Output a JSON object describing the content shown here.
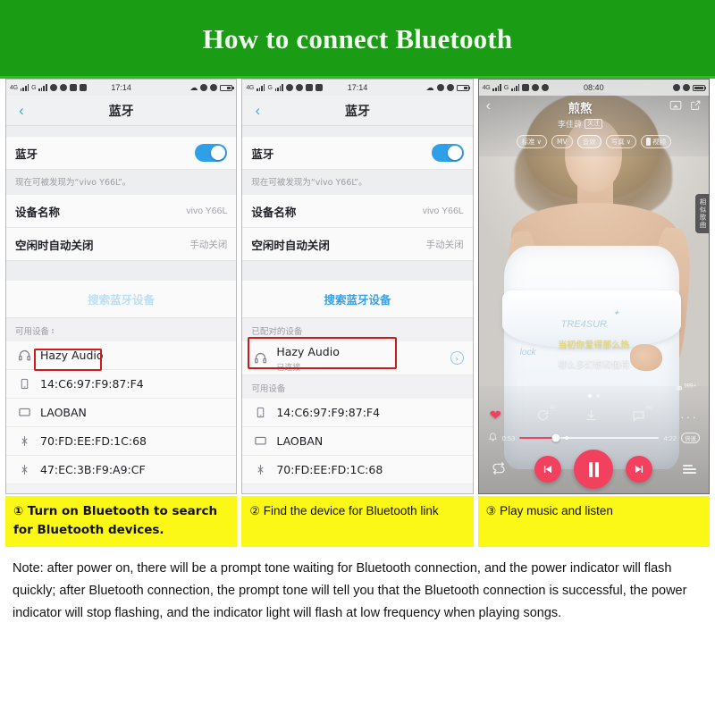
{
  "header": {
    "title": "How to connect Bluetooth",
    "bg": "#1a9d14",
    "text_color": "#f2fff0"
  },
  "accents": {
    "yellow": "#fbf717",
    "red_box": "#cf1a1a",
    "link_blue": "#3aa0e5",
    "toggle_blue": "#2f9fe8",
    "player_pink": "#f2415f"
  },
  "panel1": {
    "statusbar": {
      "net1": "4G",
      "net2": "G",
      "time": "17:14"
    },
    "nav": {
      "back": "‹",
      "title": "蓝牙"
    },
    "bluetooth_row": {
      "label": "蓝牙",
      "toggle_on": true
    },
    "discoverable_note": "现在可被发现为“vivo Y66L”。",
    "device_name_row": {
      "label": "设备名称",
      "value": "vivo Y66L"
    },
    "auto_off_row": {
      "label": "空闲时自动关闭",
      "value": "手动关闭"
    },
    "search_link": "搜索蓝牙设备",
    "available_label": "可用设备",
    "devices": [
      {
        "icon": "headphones-icon",
        "name": "Hazy Audio",
        "highlighted": true
      },
      {
        "icon": "phone-icon",
        "name": "14:C6:97:F9:87:F4",
        "highlighted": false
      },
      {
        "icon": "laptop-icon",
        "name": "LAOBAN",
        "highlighted": false
      },
      {
        "icon": "bluetooth-icon",
        "name": "70:FD:EE:FD:1C:68",
        "highlighted": false
      },
      {
        "icon": "bluetooth-icon",
        "name": "47:EC:3B:F9:A9:CF",
        "highlighted": false
      }
    ]
  },
  "panel2": {
    "statusbar": {
      "net1": "4G",
      "net2": "G",
      "time": "17:14"
    },
    "nav": {
      "back": "‹",
      "title": "蓝牙"
    },
    "bluetooth_row": {
      "label": "蓝牙",
      "toggle_on": true
    },
    "discoverable_note": "现在可被发现为“vivo Y66L”。",
    "device_name_row": {
      "label": "设备名称",
      "value": "vivo Y66L"
    },
    "auto_off_row": {
      "label": "空闲时自动关闭",
      "value": "手动关闭"
    },
    "search_link": "搜索蓝牙设备",
    "paired_label": "已配对的设备",
    "paired_device": {
      "icon": "headphones-icon",
      "name": "Hazy Audio",
      "status": "已连接",
      "chevron": "›"
    },
    "available_label": "可用设备",
    "devices": [
      {
        "icon": "phone-icon",
        "name": "14:C6:97:F9:87:F4"
      },
      {
        "icon": "laptop-icon",
        "name": "LAOBAN"
      },
      {
        "icon": "bluetooth-icon",
        "name": "70:FD:EE:FD:1C:68"
      }
    ]
  },
  "panel3": {
    "statusbar": {
      "net1": "4G",
      "net2": "G",
      "time": "08:40"
    },
    "nav": {
      "back": "‹",
      "cast_icon": "cast-icon",
      "share_icon": "share-icon"
    },
    "song_title": "煎熬",
    "artist": "李佳薛",
    "follow_label": "关注",
    "chips": [
      {
        "label": "标准",
        "caret": "∨"
      },
      {
        "label": "MV",
        "caret": ""
      },
      {
        "label": "音效",
        "caret": "",
        "highlight": true
      },
      {
        "label": "写真",
        "caret": "∨"
      },
      {
        "label": "视频",
        "caret": "",
        "icon": "video-pill-icon"
      }
    ],
    "side_tab": "相似歌曲",
    "lyrics": {
      "line1": "当初你爱得那么热",
      "line2": "哪么多幻想和值得"
    },
    "gift_badge": "999+",
    "actions": {
      "like_icon": "heart-icon",
      "recommend_icon": "refresh-circle-icon",
      "recommend_badge": "32",
      "download_icon": "download-icon",
      "comment_icon": "comment-icon",
      "comment_badge": "3w",
      "more_icon": "more-dots-icon"
    },
    "seek": {
      "bell_icon": "bell-icon",
      "current_time": "0:53",
      "total_time": "4:22",
      "progress_pct": 26,
      "speed_label": "倍速"
    },
    "controls": {
      "repeat_icon": "repeat-icon",
      "prev_icon": "previous-icon",
      "play_pause_icon": "pause-icon",
      "next_icon": "next-icon",
      "playlist_icon": "playlist-icon"
    }
  },
  "captions": [
    {
      "num": "①",
      "text": "Turn on Bluetooth to search for Bluetooth devices.",
      "bold": true
    },
    {
      "num": "②",
      "text": "Find the device for Bluetooth link",
      "bold": false
    },
    {
      "num": "③",
      "text": "Play music and listen",
      "bold": false
    }
  ],
  "note": "Note: after power on, there will be a prompt tone waiting for Bluetooth connection, and the power indicator will flash quickly; after Bluetooth connection, the prompt tone will tell you that the Bluetooth connection is successful, the power indicator will stop flashing, and the indicator light will flash at low frequency when playing songs."
}
